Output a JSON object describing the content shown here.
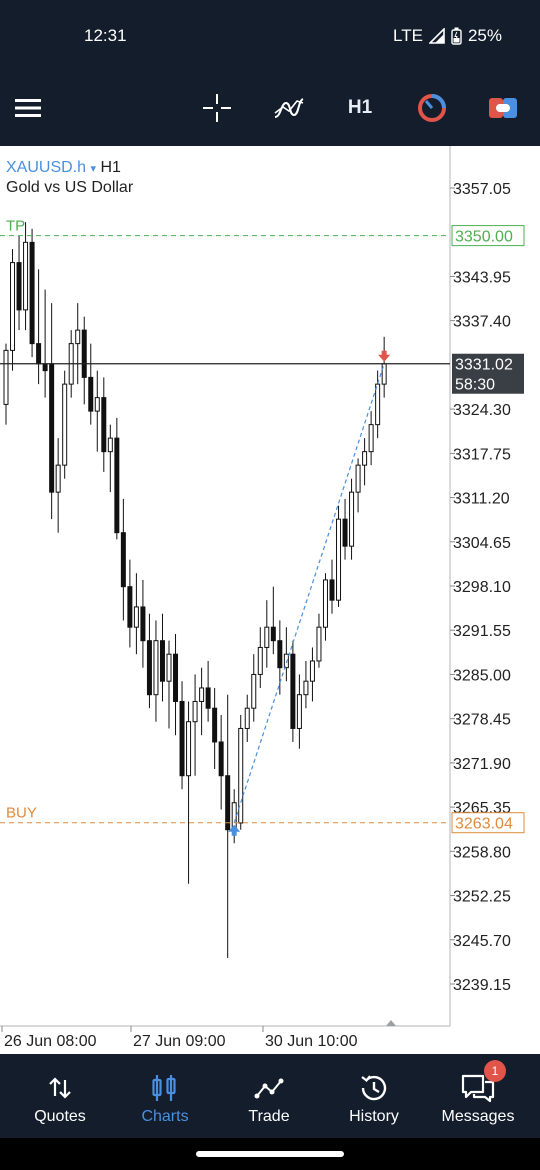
{
  "status_bar": {
    "time": "12:31",
    "network": "LTE",
    "battery": "25%"
  },
  "toolbar": {
    "timeframe": "H1"
  },
  "chart_header": {
    "symbol": "XAUUSD.h",
    "timeframe": "H1",
    "description": "Gold vs US Dollar"
  },
  "chart_data": {
    "type": "candlestick",
    "price_axis": [
      "3357.05",
      "3343.95",
      "3337.40",
      "3324.30",
      "3317.75",
      "3311.20",
      "3304.65",
      "3298.10",
      "3291.55",
      "3285.00",
      "3278.45",
      "3271.90",
      "3265.35",
      "3258.80",
      "3252.25",
      "3245.70",
      "3239.15"
    ],
    "time_axis": [
      "26 Jun 08:00",
      "27 Jun 09:00",
      "30 Jun 10:00"
    ],
    "tp": {
      "label": "TP",
      "price": "3350.00",
      "value": 3350.0
    },
    "buy": {
      "label": "BUY",
      "price": "3263.04",
      "value": 3263.04
    },
    "current": {
      "price": "3331.02",
      "value": 3331.02,
      "countdown": "58:30"
    },
    "ylim": [
      3236,
      3362
    ],
    "candles": [
      [
        3325,
        3334,
        3322,
        3333
      ],
      [
        3333,
        3348,
        3330,
        3346
      ],
      [
        3346,
        3350,
        3336,
        3339
      ],
      [
        3339,
        3352,
        3336,
        3349
      ],
      [
        3349,
        3351,
        3332,
        3334
      ],
      [
        3334,
        3345,
        3328,
        3331
      ],
      [
        3331,
        3342,
        3326,
        3330
      ],
      [
        3331,
        3340,
        3308,
        3312
      ],
      [
        3312,
        3320,
        3306,
        3316
      ],
      [
        3316,
        3330,
        3314,
        3328
      ],
      [
        3328,
        3336,
        3326,
        3334
      ],
      [
        3334,
        3340,
        3328,
        3336
      ],
      [
        3336,
        3338,
        3325,
        3329
      ],
      [
        3329,
        3334,
        3322,
        3324
      ],
      [
        3324,
        3330,
        3318,
        3326
      ],
      [
        3326,
        3329,
        3315,
        3318
      ],
      [
        3318,
        3322,
        3312,
        3320
      ],
      [
        3320,
        3323,
        3305,
        3306
      ],
      [
        3306,
        3311,
        3293,
        3298
      ],
      [
        3298,
        3302,
        3289,
        3292
      ],
      [
        3292,
        3300,
        3288,
        3295
      ],
      [
        3295,
        3299,
        3286,
        3290
      ],
      [
        3290,
        3294,
        3280,
        3282
      ],
      [
        3282,
        3293,
        3278,
        3290
      ],
      [
        3290,
        3294,
        3281,
        3284
      ],
      [
        3284,
        3290,
        3277,
        3288
      ],
      [
        3288,
        3291,
        3276,
        3281
      ],
      [
        3281,
        3284,
        3268,
        3270
      ],
      [
        3270,
        3281,
        3254,
        3278
      ],
      [
        3278,
        3285,
        3270,
        3281
      ],
      [
        3281,
        3286,
        3276,
        3283
      ],
      [
        3283,
        3287,
        3278,
        3280
      ],
      [
        3280,
        3283,
        3271,
        3275
      ],
      [
        3275,
        3279,
        3265,
        3270
      ],
      [
        3270,
        3282,
        3243,
        3262
      ],
      [
        3262,
        3268,
        3260,
        3266
      ],
      [
        3263,
        3279,
        3262,
        3277
      ],
      [
        3277,
        3282,
        3275,
        3280
      ],
      [
        3280,
        3288,
        3278,
        3285
      ],
      [
        3285,
        3292,
        3283,
        3289
      ],
      [
        3289,
        3296,
        3286,
        3292
      ],
      [
        3292,
        3298,
        3288,
        3290
      ],
      [
        3290,
        3293,
        3282,
        3286
      ],
      [
        3286,
        3292,
        3284,
        3288
      ],
      [
        3288,
        3290,
        3275,
        3277
      ],
      [
        3277,
        3285,
        3274,
        3282
      ],
      [
        3282,
        3287,
        3280,
        3284
      ],
      [
        3284,
        3289,
        3281,
        3287
      ],
      [
        3287,
        3294,
        3286,
        3292
      ],
      [
        3292,
        3300,
        3290,
        3299
      ],
      [
        3299,
        3302,
        3294,
        3296
      ],
      [
        3296,
        3310,
        3295,
        3308
      ],
      [
        3308,
        3311,
        3302,
        3304
      ],
      [
        3304,
        3314,
        3302,
        3312
      ],
      [
        3312,
        3317,
        3309,
        3316
      ],
      [
        3316,
        3320,
        3313,
        3318
      ],
      [
        3318,
        3324,
        3316,
        3322
      ],
      [
        3322,
        3330,
        3320,
        3328
      ],
      [
        3328,
        3335,
        3326,
        3331
      ]
    ]
  },
  "nav": [
    {
      "label": "Quotes",
      "icon": "sort-arrows-icon"
    },
    {
      "label": "Charts",
      "icon": "candles-icon"
    },
    {
      "label": "Trade",
      "icon": "trend-line-icon"
    },
    {
      "label": "History",
      "icon": "history-clock-icon"
    },
    {
      "label": "Messages",
      "icon": "messages-icon",
      "badge": "1"
    }
  ],
  "colors": {
    "accent": "#4a8fe0",
    "dark": "#131d2c",
    "tp": "#4caf50",
    "buy": "#e08a3c",
    "sell_marker": "#e0544a"
  }
}
